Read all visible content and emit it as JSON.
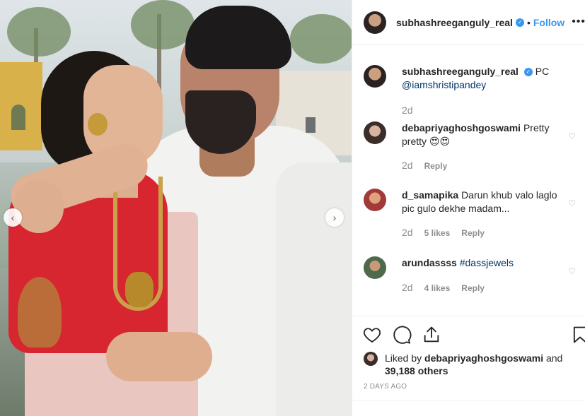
{
  "post": {
    "username": "subhashreeganguly_real",
    "follow_label": "Follow",
    "more_label": "•••"
  },
  "caption": {
    "username": "subhashreeganguly_real",
    "text": "PC",
    "mention": "@iamshristipandey",
    "time": "2d"
  },
  "comments": [
    {
      "username": "debapriyaghoshgoswami",
      "text": "Pretty pretty 😍😍",
      "time": "2d",
      "likes": "",
      "reply": "Reply"
    },
    {
      "username": "d_samapika",
      "text": "Darun khub valo laglo pic gulo dekhe madam...",
      "time": "2d",
      "likes": "5 likes",
      "reply": "Reply"
    },
    {
      "username": "arundassss",
      "text": "#dassjewels",
      "time": "2d",
      "likes": "4 likes",
      "reply": "Reply"
    }
  ],
  "likes": {
    "prefix": "Liked by",
    "liker": "debapriyaghoshgoswami",
    "suffix": "and",
    "others": "39,188 others"
  },
  "post_age": "2 DAYS AGO",
  "icons": {
    "like": "heart-icon",
    "comment": "comment-icon",
    "share": "share-icon",
    "save": "bookmark-icon",
    "prev": "chevron-left-icon",
    "next": "chevron-right-icon"
  },
  "colors": {
    "accent": "#3897f0",
    "text": "#262626",
    "muted": "#8e8e8e",
    "link": "#003569"
  }
}
